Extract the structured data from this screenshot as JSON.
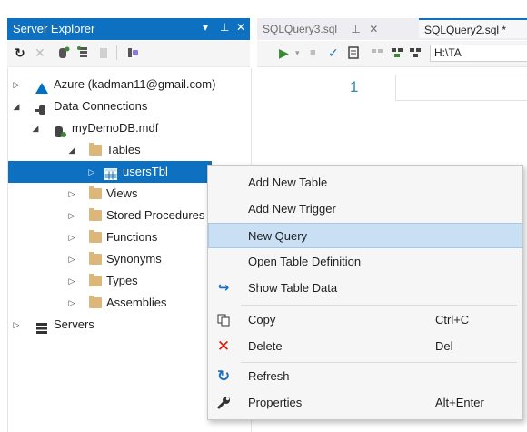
{
  "server_explorer": {
    "title": "Server Explorer",
    "title_buttons": [
      "▾",
      "⊥",
      "✕"
    ],
    "toolbar_icons": [
      "refresh-icon",
      "stop-icon",
      "connect-database-icon",
      "connect-server-icon",
      "database-properties-icon",
      "sharepoint-icon"
    ],
    "tree": [
      {
        "label": "Azure (kadman11@gmail.com)",
        "icon": "azure-icon",
        "expanded": false
      },
      {
        "label": "Data Connections",
        "icon": "data-connections-icon",
        "expanded": true
      },
      {
        "label": "myDemoDB.mdf",
        "icon": "database-icon",
        "expanded": true
      },
      {
        "label": "Tables",
        "icon": "folder-icon",
        "expanded": true
      },
      {
        "label": "usersTbl",
        "icon": "table-icon",
        "expanded": false,
        "selected": true
      },
      {
        "label": "Views",
        "icon": "folder-icon",
        "expanded": false
      },
      {
        "label": "Stored Procedures",
        "icon": "folder-icon",
        "expanded": false
      },
      {
        "label": "Functions",
        "icon": "folder-icon",
        "expanded": false
      },
      {
        "label": "Synonyms",
        "icon": "folder-icon",
        "expanded": false
      },
      {
        "label": "Types",
        "icon": "folder-icon",
        "expanded": false
      },
      {
        "label": "Assemblies",
        "icon": "folder-icon",
        "expanded": false
      },
      {
        "label": "Servers",
        "icon": "servers-icon",
        "expanded": false
      }
    ]
  },
  "tabs": [
    {
      "label": "SQLQuery3.sql",
      "pin": "⊥",
      "close": "✕"
    },
    {
      "label": "SQLQuery2.sql *"
    }
  ],
  "editor": {
    "path_text": "H:\\TA",
    "line_number": "1"
  },
  "context_menu": {
    "items": [
      {
        "label": "Add New Table",
        "icon": "",
        "shortcut": ""
      },
      {
        "label": "Add New Trigger",
        "icon": "",
        "shortcut": ""
      },
      {
        "label": "New Query",
        "icon": "",
        "shortcut": "",
        "highlighted": true
      },
      {
        "label": "Open Table Definition",
        "icon": "",
        "shortcut": ""
      },
      {
        "label": "Show Table Data",
        "icon": "show-data-icon",
        "shortcut": ""
      },
      {
        "label": "Copy",
        "icon": "copy-icon",
        "shortcut": "Ctrl+C"
      },
      {
        "label": "Delete",
        "icon": "delete-icon",
        "shortcut": "Del"
      },
      {
        "label": "Refresh",
        "icon": "refresh-icon",
        "shortcut": ""
      },
      {
        "label": "Properties",
        "icon": "wrench-icon",
        "shortcut": "Alt+Enter"
      }
    ]
  },
  "colors": {
    "accent": "#0e70c0",
    "menu_highlight": "#c9dff4",
    "delete_red": "#e51400",
    "run_green": "#388a34"
  }
}
